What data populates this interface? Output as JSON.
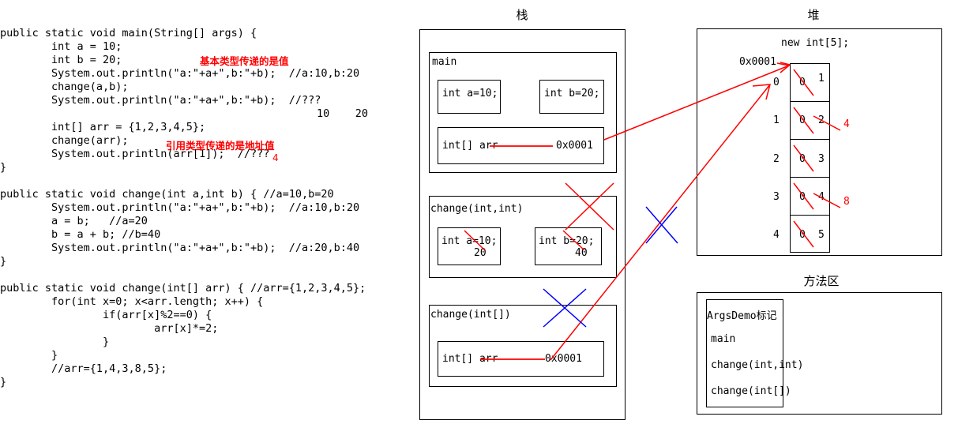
{
  "code": {
    "lines": [
      "public static void main(String[] args) {",
      "        int a = 10;",
      "        int b = 20;",
      "        System.out.println(\"a:\"+a+\",b:\"+b);  //a:10,b:20",
      "        change(a,b);",
      "        System.out.println(\"a:\"+a+\",b:\"+b);  //???",
      "",
      "        int[] arr = {1,2,3,4,5};",
      "        change(arr);",
      "        System.out.println(arr[1]);  //???",
      "}",
      "",
      "public static void change(int a,int b) { //a=10,b=20",
      "        System.out.println(\"a:\"+a+\",b:\"+b);  //a:10,b:20",
      "        a = b;   //a=20",
      "        b = a + b; //b=40",
      "        System.out.println(\"a:\"+a+\",b:\"+b);  //a:20,b:40",
      "}",
      "",
      "public static void change(int[] arr) { //arr={1,2,3,4,5};",
      "        for(int x=0; x<arr.length; x++) {",
      "                if(arr[x]%2==0) {",
      "                        arr[x]*=2;",
      "                }",
      "        }",
      "        //arr={1,4,3,8,5};",
      "}"
    ],
    "annotations": {
      "primitive_note": "基本类型传递的是值",
      "reference_note": "引用类型传递的是地址值",
      "answer_arr1": "4",
      "values_a_b": "10    20"
    }
  },
  "stack": {
    "caption": "栈",
    "frames": [
      {
        "name": "main",
        "slots": [
          {
            "label": "int a=10;"
          },
          {
            "label": "int b=20;"
          }
        ],
        "ref_slot": {
          "label": "int[] arr",
          "address": "0x0001"
        }
      },
      {
        "name": "change(int,int)",
        "slots": [
          {
            "label": "int a=10;",
            "new_value": "20"
          },
          {
            "label": "int b=20;",
            "new_value": "40"
          }
        ],
        "crossed_out": true,
        "cross_color": "#ff0000"
      },
      {
        "name": "change(int[])",
        "ref_slot": {
          "label": "int[] arr",
          "address": "0x0001"
        },
        "crossed_out": true,
        "cross_color": "#0000ff"
      }
    ]
  },
  "heap": {
    "caption": "堆",
    "allocation": "new int[5];",
    "address": "0x0001",
    "cells": [
      {
        "index": "0",
        "initial": "0",
        "value": "1",
        "new_value": ""
      },
      {
        "index": "1",
        "initial": "0",
        "value": "2",
        "new_value": "4"
      },
      {
        "index": "2",
        "initial": "0",
        "value": "3",
        "new_value": ""
      },
      {
        "index": "3",
        "initial": "0",
        "value": "4",
        "new_value": "8"
      },
      {
        "index": "4",
        "initial": "0",
        "value": "5",
        "new_value": ""
      }
    ]
  },
  "method_area": {
    "caption": "方法区",
    "class_label": "ArgsDemo标记",
    "methods": [
      "main",
      "change(int,int)",
      "change(int[])"
    ]
  },
  "colors": {
    "red": "#ff0000",
    "blue": "#0000ff",
    "black": "#000000"
  }
}
